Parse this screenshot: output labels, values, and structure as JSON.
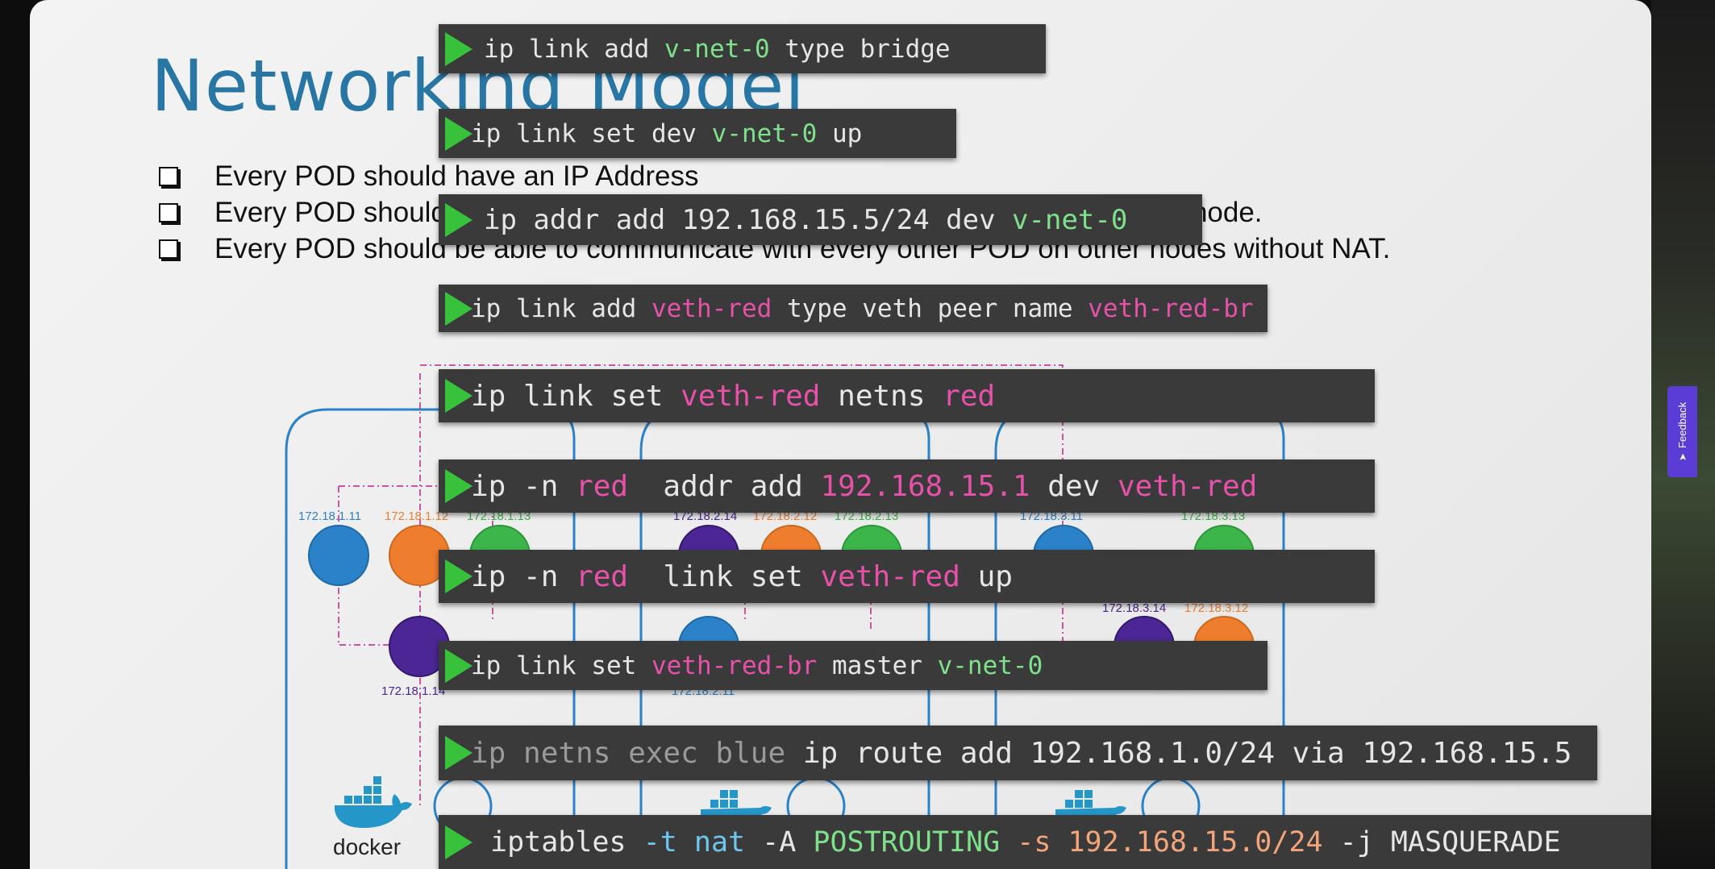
{
  "slide": {
    "title": "Networking Model",
    "bullets": [
      "Every POD should have an IP Address",
      "Every POD should be able to communicate with every other POD in the same node.",
      "Every POD should be able to communicate with every other POD on other nodes without NAT."
    ]
  },
  "diagram": {
    "node1": {
      "pod_ips": [
        "172.18.1.11",
        "172.18.1.12",
        "172.18.1.13",
        "172.18.1.14"
      ]
    },
    "node2": {
      "pod_ips": [
        "172.18.2.14",
        "172.18.2.12",
        "172.18.2.13",
        "172.18.2.11"
      ]
    },
    "node3": {
      "pod_ips": [
        "172.18.3.11",
        "172.18.3.13",
        "172.18.3.14",
        "172.18.3.12"
      ]
    },
    "docker_label": "docker",
    "colors": {
      "blue": "#2b82c9",
      "orange": "#ee7d2d",
      "green": "#3cb54a",
      "purple": "#4b2694"
    }
  },
  "commands": [
    {
      "name": "cmd-add-bridge",
      "parts": [
        {
          "t": "ip link add ",
          "c": ""
        },
        {
          "t": "v-net-0",
          "c": "g"
        },
        {
          "t": " type bridge",
          "c": ""
        }
      ]
    },
    {
      "name": "cmd-set-bridge-up",
      "parts": [
        {
          "t": "ip link set dev ",
          "c": ""
        },
        {
          "t": "v-net-0",
          "c": "g"
        },
        {
          "t": " up",
          "c": ""
        }
      ]
    },
    {
      "name": "cmd-addr-add-bridge",
      "parts": [
        {
          "t": "ip addr add 192.168.15.5/24 dev ",
          "c": ""
        },
        {
          "t": "v-net-0",
          "c": "g"
        }
      ]
    },
    {
      "name": "cmd-add-veth",
      "parts": [
        {
          "t": "ip link add ",
          "c": ""
        },
        {
          "t": "veth-red",
          "c": "p"
        },
        {
          "t": " type veth peer name ",
          "c": ""
        },
        {
          "t": "veth-red-br",
          "c": "p"
        }
      ]
    },
    {
      "name": "cmd-set-netns",
      "parts": [
        {
          "t": "ip link set ",
          "c": ""
        },
        {
          "t": "veth-red",
          "c": "p"
        },
        {
          "t": " netns ",
          "c": ""
        },
        {
          "t": "red",
          "c": "p"
        }
      ]
    },
    {
      "name": "cmd-ns-addr-add",
      "parts": [
        {
          "t": "ip -n ",
          "c": ""
        },
        {
          "t": "red",
          "c": "p"
        },
        {
          "t": "  addr add ",
          "c": ""
        },
        {
          "t": "192.168.15.1",
          "c": "p"
        },
        {
          "t": " dev ",
          "c": ""
        },
        {
          "t": "veth-red",
          "c": "p"
        }
      ]
    },
    {
      "name": "cmd-ns-link-up",
      "parts": [
        {
          "t": "ip -n ",
          "c": ""
        },
        {
          "t": "red",
          "c": "p"
        },
        {
          "t": "  link set ",
          "c": ""
        },
        {
          "t": "veth-red",
          "c": "p"
        },
        {
          "t": " up",
          "c": ""
        }
      ]
    },
    {
      "name": "cmd-set-master",
      "parts": [
        {
          "t": "ip link set ",
          "c": ""
        },
        {
          "t": "veth-red-br",
          "c": "p"
        },
        {
          "t": " master ",
          "c": ""
        },
        {
          "t": "v-net-0",
          "c": "g"
        }
      ]
    },
    {
      "name": "cmd-route-add",
      "parts": [
        {
          "t": "ip netns exec blue",
          "c": "gr"
        },
        {
          "t": " ip route add 192.168.1.0/24 via 192.168.15.5",
          "c": ""
        }
      ]
    },
    {
      "name": "cmd-iptables",
      "parts": [
        {
          "t": "iptables ",
          "c": ""
        },
        {
          "t": "-t nat",
          "c": "b"
        },
        {
          "t": " -A ",
          "c": ""
        },
        {
          "t": "POSTROUTING",
          "c": "g"
        },
        {
          "t": " -s ",
          "c": "o"
        },
        {
          "t": "192.168.15.0/24",
          "c": "o"
        },
        {
          "t": " -j MASQUERADE",
          "c": ""
        }
      ]
    }
  ],
  "feedback": {
    "label": "Feedback",
    "icon": "arrow-icon"
  }
}
